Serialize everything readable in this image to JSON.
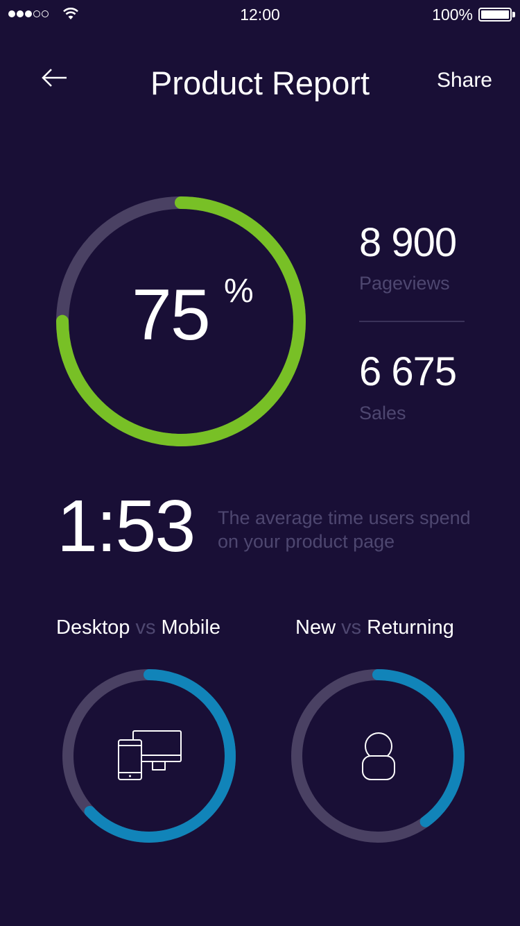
{
  "status_bar": {
    "time": "12:00",
    "battery": "100%",
    "signal_bars_filled": 3,
    "signal_bars_total": 5
  },
  "header": {
    "title": "Product Report",
    "share_label": "Share",
    "back_icon": "arrow-left-icon"
  },
  "conversion": {
    "value": "75",
    "unit": "%",
    "fraction": 0.75,
    "track_color": "#4a4163",
    "fill_color": "#78c026"
  },
  "stats": [
    {
      "value": "8 900",
      "label": "Pageviews"
    },
    {
      "value": "6 675",
      "label": "Sales"
    }
  ],
  "avg_time": {
    "value": "1:53",
    "description_line1": "The average time users spend",
    "description_line2": "on your product page"
  },
  "comparisons": [
    {
      "left": "Desktop",
      "vs": "vs",
      "right": "Mobile",
      "icon": "devices-icon",
      "fraction": 0.63,
      "fill_color": "#1184b9"
    },
    {
      "left": "New",
      "vs": "vs",
      "right": "Returning",
      "icon": "user-icon",
      "fraction": 0.4,
      "fill_color": "#1184b9"
    }
  ]
}
